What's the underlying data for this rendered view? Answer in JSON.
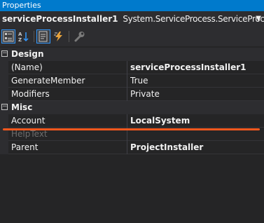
{
  "window": {
    "title": "Properties"
  },
  "object_selector": {
    "name": "serviceProcessInstaller1",
    "type": "System.ServiceProcess.ServiceProcessInstall",
    "dropdown_icon": "chevron-down-icon"
  },
  "toolbar": {
    "buttons": [
      {
        "icon": "categorized-icon",
        "active": true
      },
      {
        "icon": "alphabetical-icon",
        "active": false
      },
      {
        "icon": "properties-icon",
        "active": true
      },
      {
        "icon": "events-lightning-icon",
        "active": false
      },
      {
        "icon": "property-pages-wrench-icon",
        "active": false
      }
    ]
  },
  "grid": {
    "categories": [
      {
        "label": "Design",
        "toggle": "⊟",
        "properties": [
          {
            "name": "(Name)",
            "value": "serviceProcessInstaller1",
            "bold": true
          },
          {
            "name": "GenerateMember",
            "value": "True",
            "bold": false
          },
          {
            "name": "Modifiers",
            "value": "Private",
            "bold": false
          }
        ]
      },
      {
        "label": "Misc",
        "toggle": "⊟",
        "properties": [
          {
            "name": "Account",
            "value": "LocalSystem",
            "bold": true
          },
          {
            "name": "HelpText",
            "value": "",
            "bold": false,
            "disabled": true
          },
          {
            "name": "Parent",
            "value": "ProjectInstaller",
            "bold": true
          }
        ]
      }
    ]
  },
  "colors": {
    "accent": "#007acc",
    "annotation": "#f7581e",
    "background": "#252526"
  }
}
